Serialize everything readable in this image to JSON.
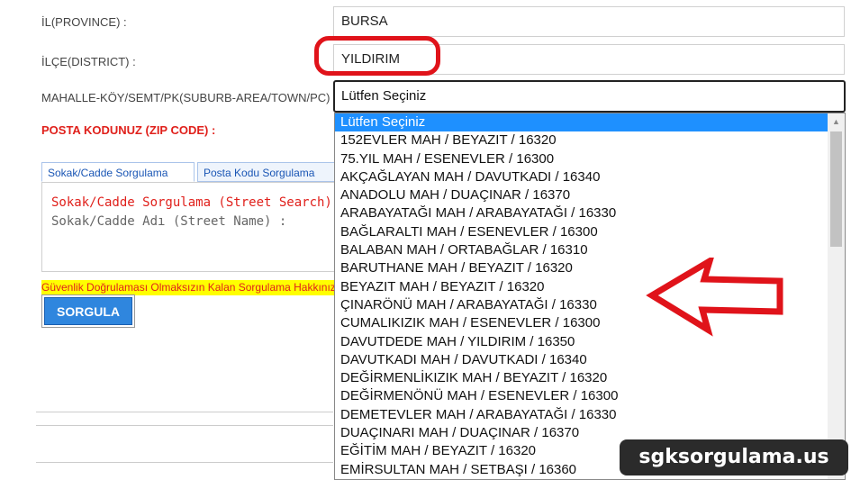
{
  "form": {
    "province_label": "İL(PROVINCE) :",
    "province_value": "BURSA",
    "district_label": "İLÇE(DISTRICT) :",
    "district_value": "YILDIRIM",
    "neighborhood_label": "MAHALLE-KÖY/SEMT/PK(SUBURB-AREA/TOWN/PC) :",
    "neighborhood_value": "Lütfen Seçiniz",
    "zip_label": "POSTA KODUNUZ (ZIP CODE) :"
  },
  "tabs": [
    {
      "label": "Sokak/Cadde Sorgulama",
      "active": true
    },
    {
      "label": "Posta Kodu Sorgulama",
      "active": false
    }
  ],
  "panel": {
    "title": "Sokak/Cadde Sorgulama (Street Search)",
    "street_label": "Sokak/Cadde Adı (Street Name) :"
  },
  "warning": "Güvenlik Doğrulaması Olmaksızın Kalan Sorgulama Hakkınız",
  "query_button": "SORGULA",
  "dropdown": {
    "options": [
      "Lütfen Seçiniz",
      "152EVLER MAH / BEYAZIT / 16320",
      "75.YIL MAH / ESENEVLER / 16300",
      "AKÇAĞLAYAN MAH / DAVUTKADI / 16340",
      "ANADOLU MAH / DUAÇINAR / 16370",
      "ARABAYATAĞI MAH / ARABAYATAĞI / 16330",
      "BAĞLARALTI MAH / ESENEVLER / 16300",
      "BALABAN MAH / ORTABAĞLAR / 16310",
      "BARUTHANE MAH / BEYAZIT / 16320",
      "BEYAZIT MAH / BEYAZIT / 16320",
      "ÇINARÖNÜ MAH / ARABAYATAĞI / 16330",
      "CUMALIKIZIK MAH / ESENEVLER / 16300",
      "DAVUTDEDE MAH / YILDIRIM / 16350",
      "DAVUTKADI MAH / DAVUTKADI / 16340",
      "DEĞİRMENLİKIZIK MAH / BEYAZIT / 16320",
      "DEĞİRMENÖNÜ MAH / ESENEVLER / 16300",
      "DEMETEVLER MAH / ARABAYATAĞI / 16330",
      "DUAÇINARI MAH / DUAÇINAR / 16370",
      "EĞİTİM MAH / BEYAZIT / 16320",
      "EMİRSULTAN MAH / SETBAŞI / 16360"
    ],
    "selected_index": 0
  },
  "watermark": "sgksorgulama.us",
  "colors": {
    "accent_red": "#e0201b",
    "selected_blue": "#1e90ff",
    "button_blue": "#2f86de"
  }
}
